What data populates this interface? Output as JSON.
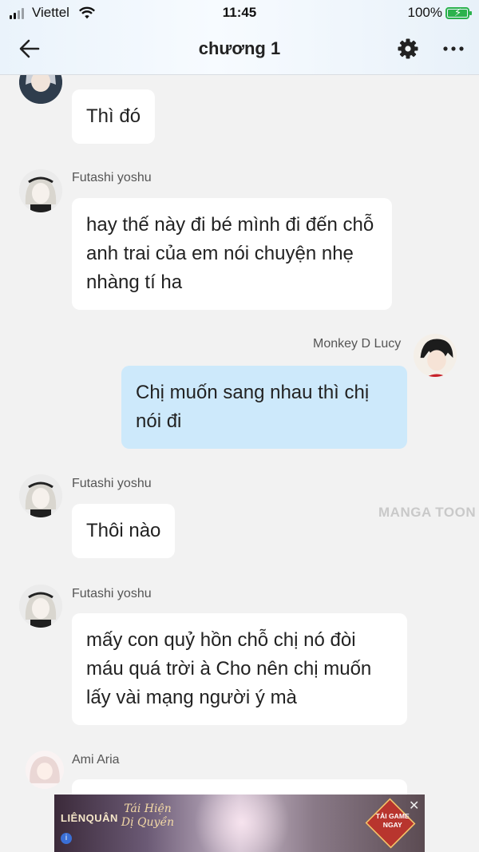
{
  "status_bar": {
    "carrier": "Viettel",
    "time": "11:45",
    "battery": "100%"
  },
  "nav": {
    "title": "chương 1"
  },
  "messages": [
    {
      "sender": "",
      "text": "Thì đó",
      "side": "left"
    },
    {
      "sender": "Futashi yoshu",
      "text": "hay thế này đi bé mình đi đến chỗ anh trai của em nói chuyện nhẹ nhàng tí ha",
      "side": "left"
    },
    {
      "sender": "Monkey D Lucy",
      "text": "Chị muốn sang nhau thì chị nói đi",
      "side": "right"
    },
    {
      "sender": "Futashi yoshu",
      "text": "Thôi nào",
      "side": "left"
    },
    {
      "sender": "Futashi yoshu",
      "text": "mấy con quỷ hồn chỗ chị nó đòi máu quá trời à Cho nên chị muốn lấy vài mạng người ý mà",
      "side": "left"
    },
    {
      "sender": "Ami Aria",
      "text": "",
      "side": "left"
    }
  ],
  "watermark": "MANGA TOON",
  "ad": {
    "brand": "LIÊNQUÂN",
    "promo": "Tái Hiện Dị Quyền",
    "cta": "TẢI GAME NGAY",
    "close": "✕"
  },
  "icons": [
    "back-arrow-icon",
    "gear-icon",
    "more-icon",
    "wifi-icon",
    "battery-icon",
    "signal-icon"
  ]
}
